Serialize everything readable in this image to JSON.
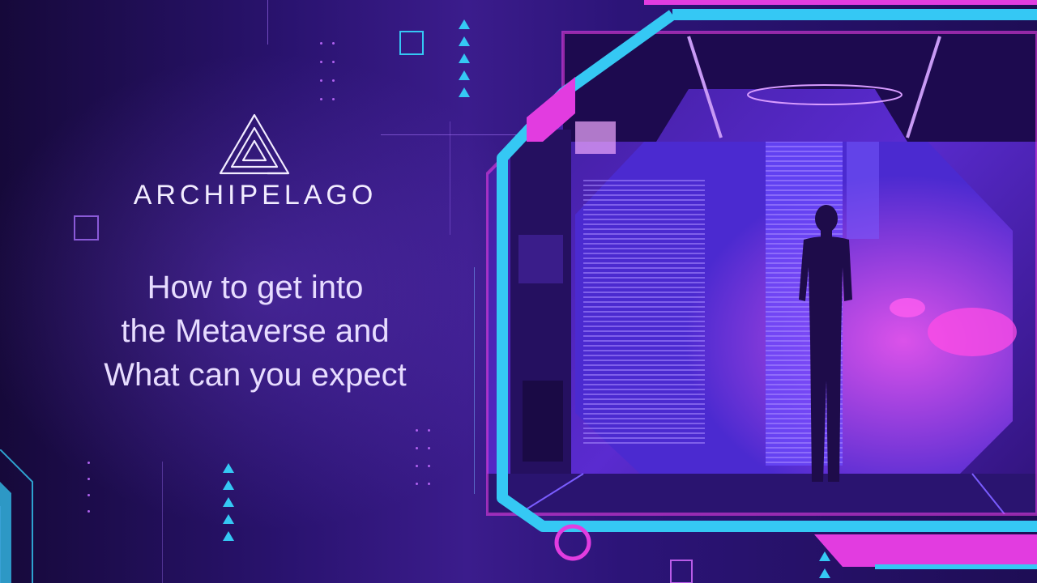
{
  "brand": {
    "name": "ARCHIPELAGO",
    "logo_icon": "impossible-triangle-icon"
  },
  "headline": {
    "line1": "How to get into",
    "line2": "the Metaverse and",
    "line3": "What can you expect"
  },
  "colors": {
    "cyan": "#35c8f4",
    "magenta": "#e23ce0",
    "purple_bg": "#2a1370",
    "text": "#e7dcff"
  },
  "scene": {
    "description_icon": "person-silhouette-icon"
  }
}
